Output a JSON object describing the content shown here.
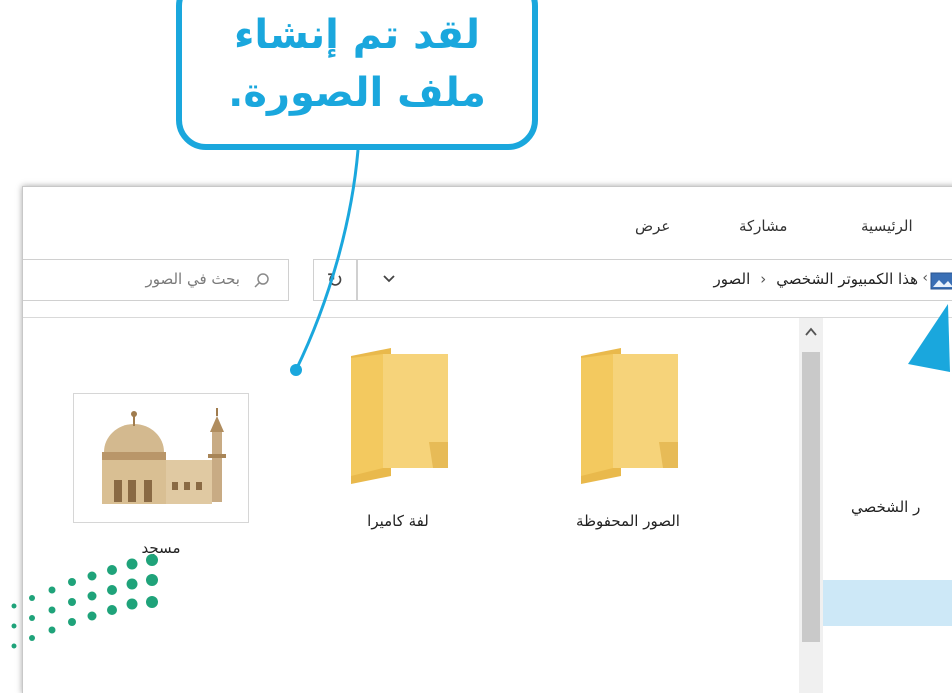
{
  "callout": {
    "line1": "لقد تم إنشاء",
    "line2": "ملف الصورة."
  },
  "ribbon": {
    "tabs": [
      "الرئيسية",
      "مشاركة",
      "عرض"
    ]
  },
  "address_bar": {
    "breadcrumb": [
      "هذا الكمبيوتر الشخصي",
      "الصور"
    ],
    "refresh_icon": "↻",
    "dropdown_icon": "chevron-down-icon"
  },
  "search": {
    "placeholder": "بحث في الصور"
  },
  "files": [
    {
      "name": "الصور المحفوظة",
      "type": "folder"
    },
    {
      "name": "لفة كاميرا",
      "type": "folder"
    },
    {
      "name": "مسجد",
      "type": "image"
    }
  ],
  "nav_pane": {
    "items": [
      "ر الشخصي"
    ]
  },
  "colors": {
    "accent": "#1aa7dd",
    "folder": "#f6d37a",
    "selection": "#cde8f7",
    "logo_green": "#1fa37a"
  }
}
